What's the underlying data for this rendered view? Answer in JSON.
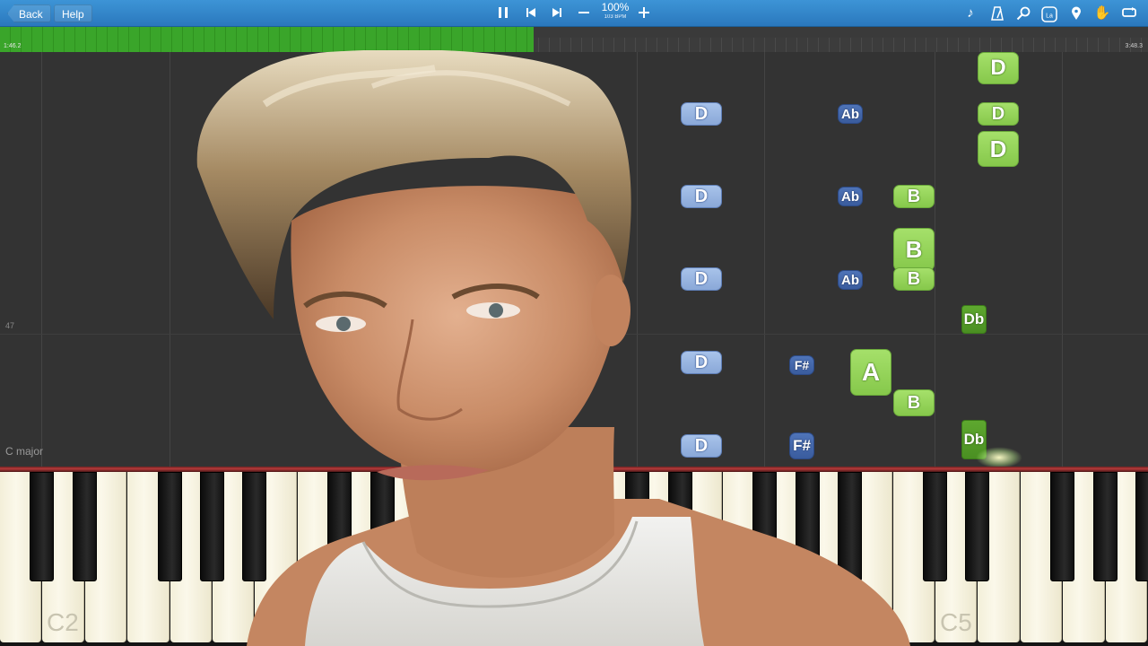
{
  "toolbar": {
    "back_label": "Back",
    "help_label": "Help",
    "speed_percent": "100%",
    "speed_bpm": "103 BPM",
    "icons": [
      "pause-icon",
      "skip-back-icon",
      "skip-forward-icon",
      "minus-icon",
      "plus-icon",
      "note-icon",
      "metronome-icon",
      "search-icon",
      "label-icon",
      "marker-icon",
      "hand-icon",
      "loop-icon"
    ],
    "label_icon_text": "La"
  },
  "progress": {
    "time_start": "1:46.2",
    "time_end": "3:48.3",
    "fraction": 0.465
  },
  "roll": {
    "measure_number": "47",
    "key_signature": "C major",
    "notes": [
      {
        "name": "D",
        "kind": "green"
      },
      {
        "name": "D",
        "kind": "blue"
      },
      {
        "name": "Ab",
        "kind": "dblue"
      },
      {
        "name": "D",
        "kind": "green"
      },
      {
        "name": "D",
        "kind": "green"
      },
      {
        "name": "D",
        "kind": "blue"
      },
      {
        "name": "Ab",
        "kind": "dblue"
      },
      {
        "name": "B",
        "kind": "green"
      },
      {
        "name": "B",
        "kind": "green"
      },
      {
        "name": "D",
        "kind": "blue"
      },
      {
        "name": "Ab",
        "kind": "dblue"
      },
      {
        "name": "B",
        "kind": "green"
      },
      {
        "name": "Db",
        "kind": "dgreen"
      },
      {
        "name": "D",
        "kind": "blue"
      },
      {
        "name": "F#",
        "kind": "dblue"
      },
      {
        "name": "A",
        "kind": "green"
      },
      {
        "name": "B",
        "kind": "green"
      },
      {
        "name": "D",
        "kind": "blue"
      },
      {
        "name": "F#",
        "kind": "dblue"
      },
      {
        "name": "Db",
        "kind": "dgreen"
      }
    ]
  },
  "piano": {
    "label_c2": "C2",
    "label_c5": "C5"
  },
  "colors": {
    "toolbar": "#2f86cc",
    "progress_fill": "#37a028",
    "note_blue": "#8aa8d8",
    "note_green": "#96d45a"
  }
}
